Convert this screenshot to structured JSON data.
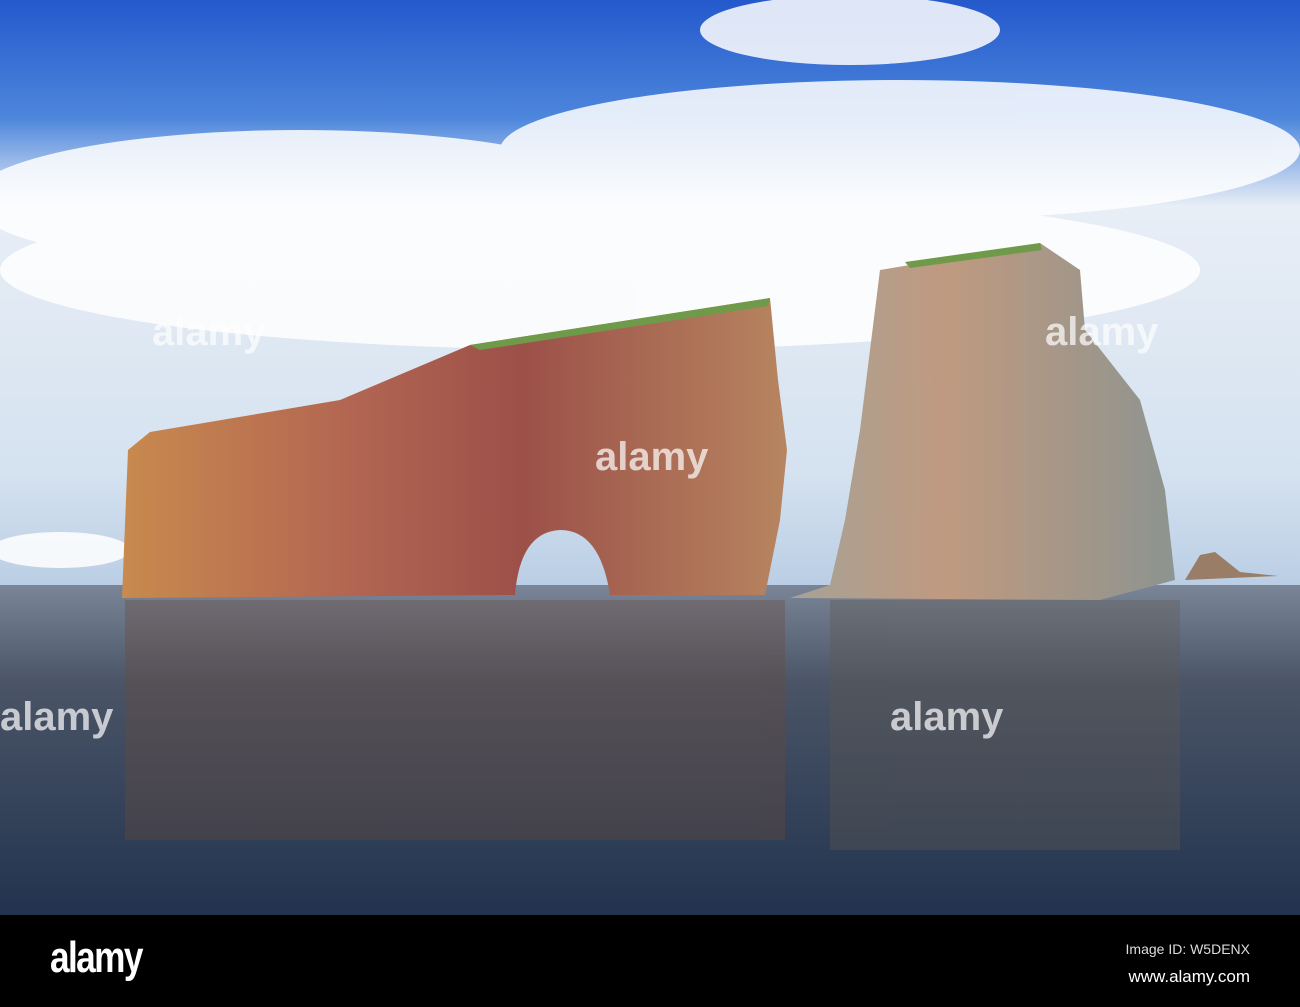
{
  "photo": {
    "subject": "Percé Rock sea stacks",
    "colors": {
      "sky_top": "#2a62d4",
      "sky_low": "#dfe9f4",
      "water": "#3b4a5c",
      "rock": "#b8664c",
      "rock_grey": "#a9a79c"
    }
  },
  "watermark": {
    "text": "alamy"
  },
  "footer": {
    "logo": "alamy",
    "image_id": "Image ID: W5DENX",
    "url": "www.alamy.com"
  }
}
